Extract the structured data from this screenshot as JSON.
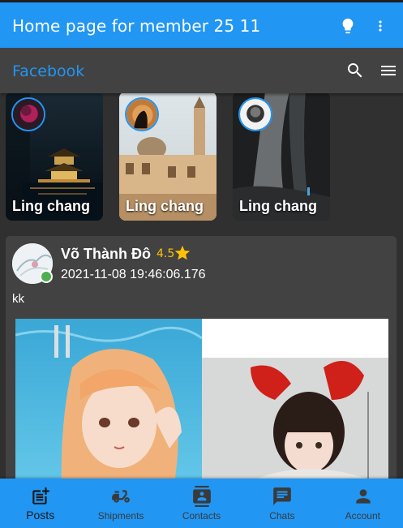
{
  "appbar": {
    "title": "Home page for member 25 11",
    "bg": "#2196f3",
    "actions": [
      "lightbulb-icon",
      "more-vert-icon"
    ]
  },
  "subbar": {
    "title": "Facebook",
    "title_color": "#2196f3",
    "actions": [
      "search-icon",
      "menu-icon"
    ]
  },
  "stories": [
    {
      "name": "Ling chang"
    },
    {
      "name": "Ling chang"
    },
    {
      "name": "Ling chang"
    }
  ],
  "post": {
    "author": "Võ Thành Đô",
    "rating": "4.5",
    "date": "2021-11-08 19:46:06.176",
    "text": "kk",
    "online": true
  },
  "bottom_nav": {
    "active_index": 0,
    "items": [
      {
        "label": "Posts",
        "icon": "post-add-icon"
      },
      {
        "label": "Shipments",
        "icon": "delivery-scooter-icon"
      },
      {
        "label": "Contacts",
        "icon": "contacts-icon"
      },
      {
        "label": "Chats",
        "icon": "chat-icon"
      },
      {
        "label": "Account",
        "icon": "person-icon"
      }
    ]
  },
  "colors": {
    "primary": "#2196f3",
    "background": "#303030",
    "card": "#424242",
    "rating": "#ffc107",
    "online": "#4caf50"
  }
}
